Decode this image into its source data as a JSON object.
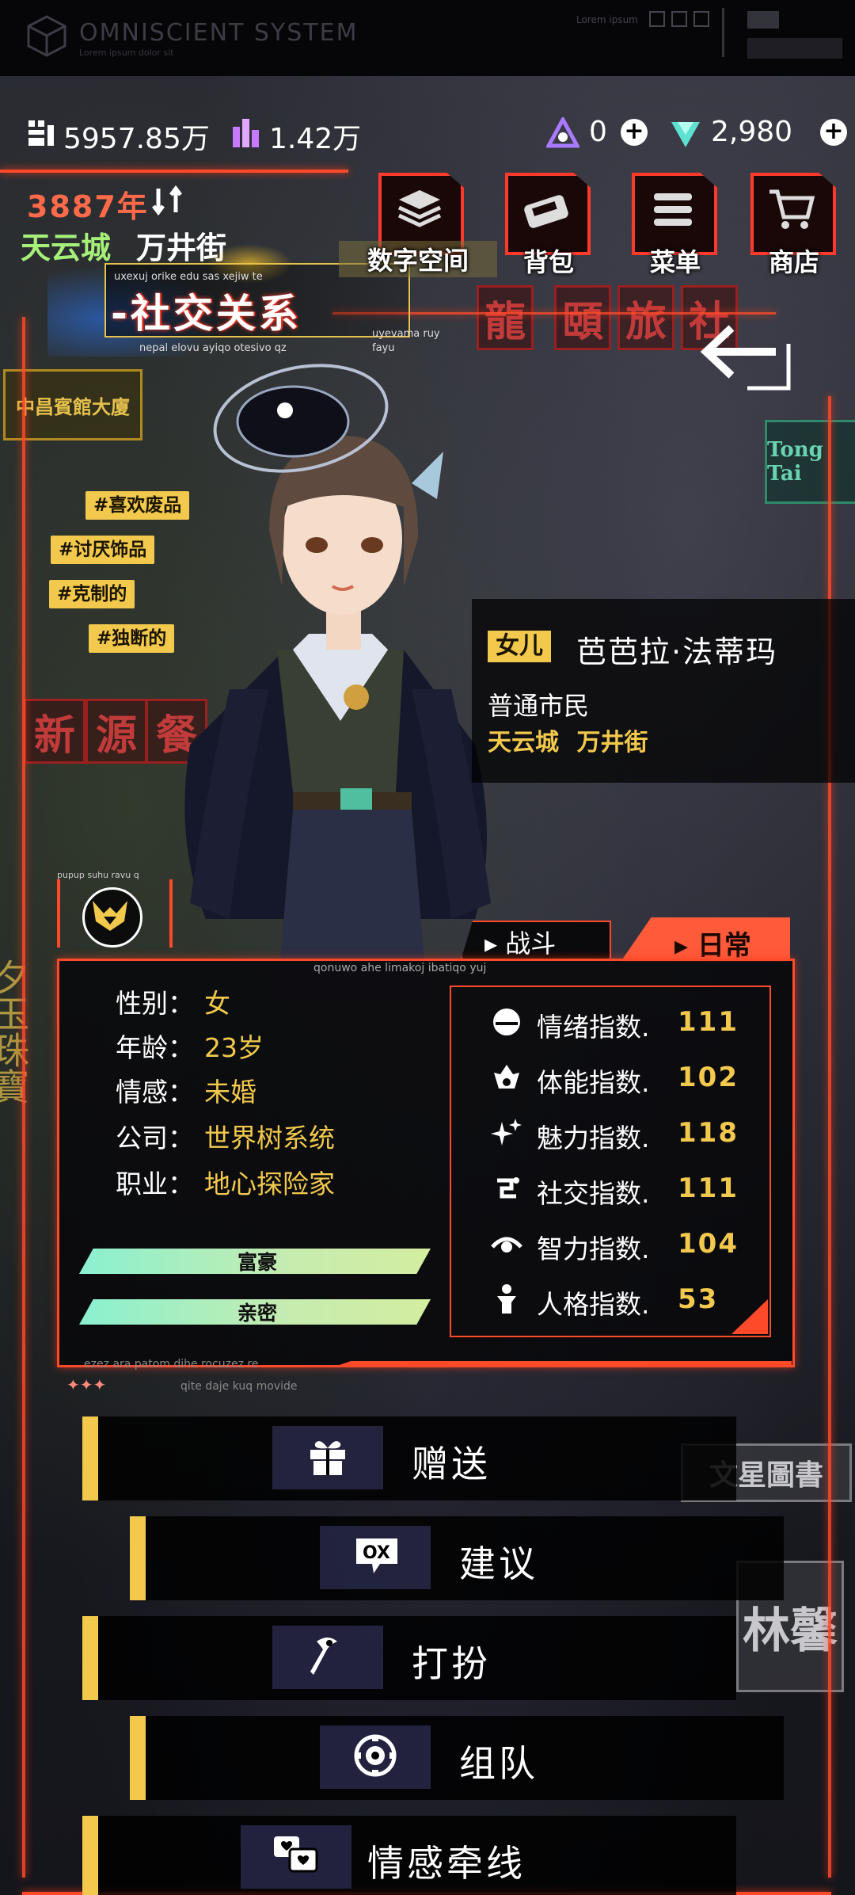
{
  "system": {
    "title": "OMNISCIENT SYSTEM",
    "subtitle": "Lorem ipsum dolor sit",
    "corner_text": "Lorem ipsum"
  },
  "currency": {
    "coins": "5957.85万",
    "crystals": "1.42万",
    "triangle": "0",
    "gems": "2,980"
  },
  "header": {
    "year": "3887年",
    "city": "天云城",
    "street": "万井街",
    "section_title": "-社交关系",
    "lorem1": "uxexuj orike edu sas xejiw te",
    "lorem2": "nepal elovu ayiqo otesivo qz",
    "lorem2_tail": "fayu",
    "lorem3": "uyevama ruy"
  },
  "menu": [
    {
      "label": "数字空间",
      "icon": "layers-icon"
    },
    {
      "label": "背包",
      "icon": "bag-icon"
    },
    {
      "label": "菜单",
      "icon": "menu-icon"
    },
    {
      "label": "商店",
      "icon": "cart-icon"
    }
  ],
  "tags": [
    "#喜欢废品",
    "#讨厌饰品",
    "#克制的",
    "#独断的"
  ],
  "character": {
    "relation": "女儿",
    "name": "芭芭拉·法蒂玛",
    "status": "普通市民",
    "city": "天云城",
    "street": "万井街",
    "avatar_lorem": "pupup suhu ravu q"
  },
  "tabs": {
    "battle": "战斗",
    "daily": "日常"
  },
  "stats_lorem_top": "qonuwo ahe limakoj ibatiqo yuj",
  "attributes": [
    {
      "label": "性别：",
      "value": "女"
    },
    {
      "label": "年龄：",
      "value": "23岁"
    },
    {
      "label": "情感：",
      "value": "未婚"
    },
    {
      "label": "公司：",
      "value": "世界树系统"
    },
    {
      "label": "职业：",
      "value": "地心探险家"
    }
  ],
  "indices": [
    {
      "label": "情绪指数.",
      "value": "111",
      "icon": "mood-icon"
    },
    {
      "label": "体能指数.",
      "value": "102",
      "icon": "fire-icon"
    },
    {
      "label": "魅力指数.",
      "value": "118",
      "icon": "sparkle-icon"
    },
    {
      "label": "社交指数.",
      "value": "111",
      "icon": "social-icon"
    },
    {
      "label": "智力指数.",
      "value": "104",
      "icon": "eye-icon"
    },
    {
      "label": "人格指数.",
      "value": "53",
      "icon": "person-icon"
    }
  ],
  "bars": [
    {
      "label": "富豪"
    },
    {
      "label": "亲密"
    }
  ],
  "stats_lorem_b1": "ezez ara patom dihe rocuzez re",
  "stats_lorem_b2": "qite daje kuq movide",
  "actions": [
    {
      "label": "赠送",
      "icon": "gift-icon"
    },
    {
      "label": "建议",
      "icon": "chat-ox-icon"
    },
    {
      "label": "打扮",
      "icon": "dress-icon"
    },
    {
      "label": "组队",
      "icon": "team-icon"
    },
    {
      "label": "情感牵线",
      "icon": "hearts-chat-icon"
    }
  ],
  "bg_signs": [
    "龍",
    "頤",
    "旅",
    "社",
    "新",
    "源",
    "餐",
    "中昌賓館大廈",
    "Tong Tai",
    "文星圖書",
    "林馨",
    "夕玉珠寶"
  ],
  "colors": {
    "neon": "#ff4a2a",
    "accent_yellow": "#f2c94c",
    "city_green": "#a6f07a"
  }
}
